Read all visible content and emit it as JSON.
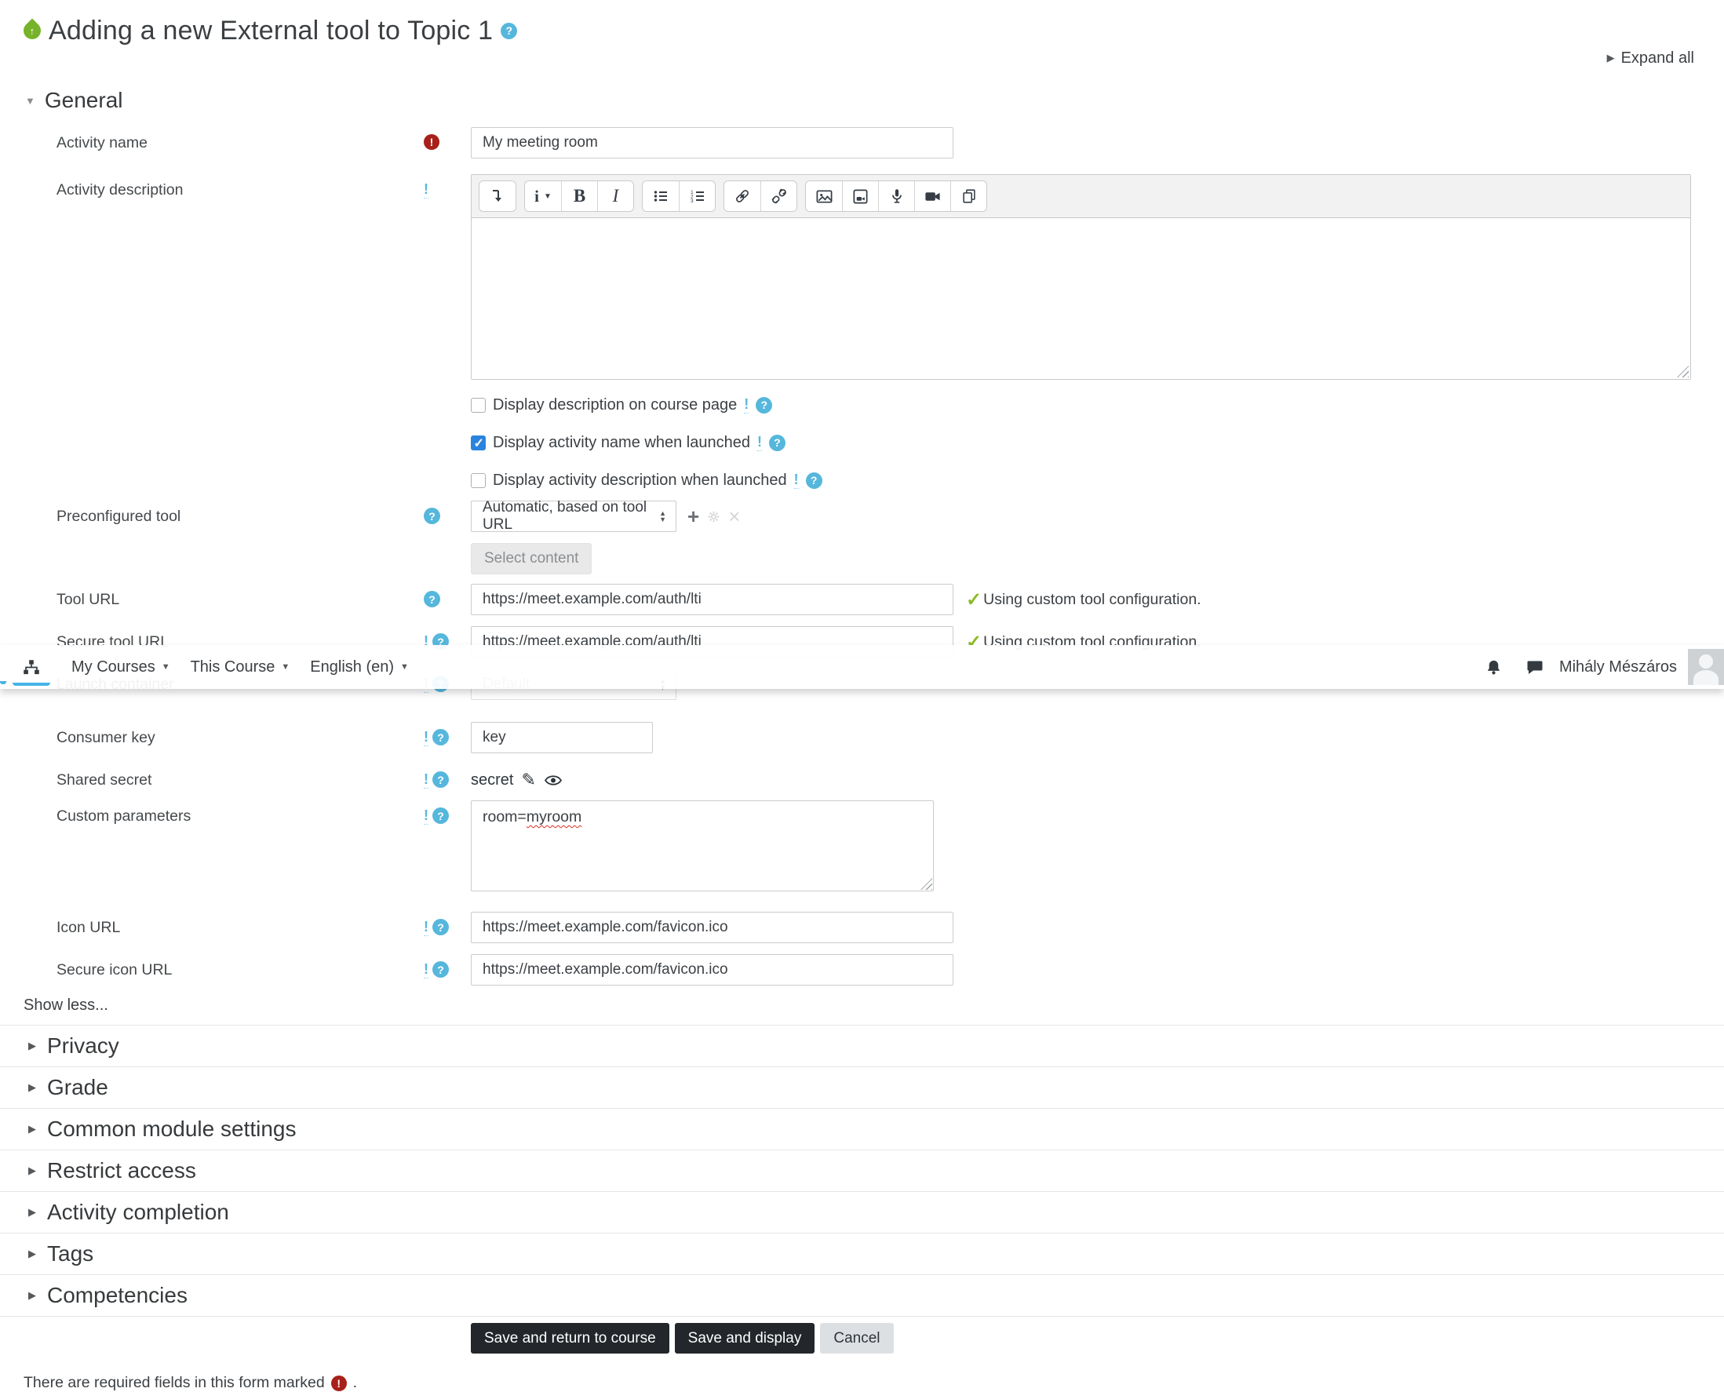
{
  "header": {
    "title": "Adding a new External tool to Topic 1",
    "expand_all": "Expand all"
  },
  "navbar": {
    "items": [
      {
        "label": "My Courses"
      },
      {
        "label": "This Course"
      },
      {
        "label": "English (en)"
      }
    ],
    "user_name": "Mihály Mészáros",
    "icons": [
      "sitemap-icon",
      "notifications-bell-icon",
      "messages-icon",
      "avatar"
    ]
  },
  "general": {
    "heading": "General",
    "activity_name": {
      "label": "Activity name",
      "value": "My meeting room"
    },
    "activity_description": {
      "label": "Activity description",
      "value": ""
    },
    "editor": {
      "styles_label": "i",
      "bold_label": "B",
      "italic_label": "I",
      "toolbar_icons": [
        "collapse-toolbar-icon",
        "styles-menu",
        "bold",
        "italic",
        "unordered-list-icon",
        "ordered-list-icon",
        "link-icon",
        "unlink-icon",
        "image-icon",
        "media-icon",
        "record-audio-icon",
        "record-video-icon",
        "manage-files-icon"
      ]
    },
    "display_description": {
      "label": "Display description on course page",
      "checked": false
    },
    "display_activity_name": {
      "label": "Display activity name when launched",
      "checked": true
    },
    "display_activity_description": {
      "label": "Display activity description when launched",
      "checked": false
    },
    "preconfigured_tool": {
      "label": "Preconfigured tool",
      "value": "Automatic, based on tool URL",
      "select_content_label": "Select content"
    },
    "tool_url": {
      "label": "Tool URL",
      "value": "https://meet.example.com/auth/lti",
      "status": "Using custom tool configuration."
    },
    "secure_tool_url": {
      "label": "Secure tool URL",
      "value": "https://meet.example.com/auth/lti",
      "status": "Using custom tool configuration."
    },
    "launch_container": {
      "label": "Launch container",
      "value": "Default"
    },
    "consumer_key": {
      "label": "Consumer key",
      "value": "key"
    },
    "shared_secret": {
      "label": "Shared secret",
      "value": "secret"
    },
    "custom_parameters": {
      "label": "Custom parameters",
      "value_prefix": "room=",
      "value_misspelled": "myroom"
    },
    "icon_url": {
      "label": "Icon URL",
      "value": "https://meet.example.com/favicon.ico"
    },
    "secure_icon_url": {
      "label": "Secure icon URL",
      "value": "https://meet.example.com/favicon.ico"
    },
    "show_less": "Show less..."
  },
  "collapsed_sections": [
    {
      "label": "Privacy"
    },
    {
      "label": "Grade"
    },
    {
      "label": "Common module settings"
    },
    {
      "label": "Restrict access"
    },
    {
      "label": "Activity completion"
    },
    {
      "label": "Tags"
    },
    {
      "label": "Competencies"
    }
  ],
  "actions": {
    "save_return": "Save and return to course",
    "save_display": "Save and display",
    "cancel": "Cancel"
  },
  "footer": {
    "required_note": "There are required fields in this form marked",
    "suffix": "."
  },
  "colors": {
    "accent_blue": "#45b4e8",
    "help_blue": "#56b7dc",
    "required_red": "#a8201a",
    "success_green": "#8aba25",
    "checkbox_blue": "#2a84dd",
    "button_dark": "#23272b"
  }
}
